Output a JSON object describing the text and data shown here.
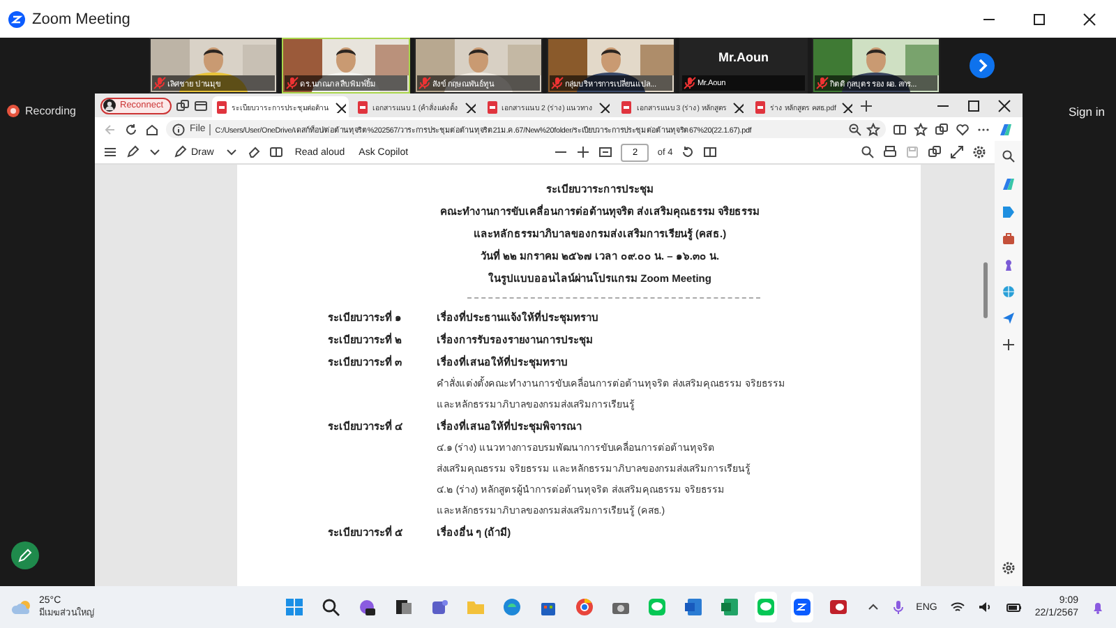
{
  "window": {
    "title": "Zoom Meeting"
  },
  "participants": [
    {
      "name": "เลิศชาย ปานมุข",
      "kind": "video",
      "muted": true,
      "speaking": false
    },
    {
      "name": "ดร.นภณภล สืบพิมพ์ยิ้ม",
      "kind": "video",
      "muted": true,
      "speaking": true
    },
    {
      "name": "สังข์ กฤษณพันธ์ทูน",
      "kind": "video",
      "muted": true,
      "speaking": false
    },
    {
      "name": "กลุ่มบริหารการเปลี่ยนแปล...",
      "kind": "video",
      "muted": true,
      "speaking": false
    },
    {
      "name": "Mr.Aoun",
      "kind": "name_only",
      "display": "Mr.Aoun",
      "muted": true,
      "speaking": false
    },
    {
      "name": "กิตติ กุลบุตร รอง ผอ. สกร...",
      "kind": "video",
      "muted": true,
      "speaking": false
    }
  ],
  "recording": {
    "label": "Recording"
  },
  "sign_in": "Sign in",
  "browser": {
    "profile_button": "Reconnect",
    "tabs": [
      {
        "label": "ระเบียบวาระการประชุมต่อต้าน",
        "selected": true
      },
      {
        "label": "เอกสารแนบ 1 (คำสั่งแต่งตั้ง",
        "selected": false
      },
      {
        "label": "เอกสารแนบ 2 (ร่าง) แนวทาง",
        "selected": false
      },
      {
        "label": "เอกสารแนบ 3 (ร่าง) หลักสูตร",
        "selected": false
      },
      {
        "label": "ร่าง หลักสูตร คสธ.pdf",
        "selected": false
      }
    ],
    "address": {
      "scheme": "File",
      "url": "C:/Users/User/OneDrive/เดสก์ท็อป/ต่อต้านทุจริต%202567/วาระการประชุมต่อต้านทุจริต21ม.ค.67/New%20folder/ระเบียบวาระการประชุมต่อต้านทุจริต67%20(22.1.67).pdf"
    },
    "pdf_toolbar": {
      "draw": "Draw",
      "read_aloud": "Read aloud",
      "ask_copilot": "Ask Copilot",
      "page": "2",
      "page_count": "of 4"
    },
    "document": {
      "heading": [
        "ระเบียบวาระการประชุม",
        "คณะทำงานการขับเคลื่อนการต่อต้านทุจริต ส่งเสริมคุณธรรม จริยธรรม",
        "และหลักธรรมาภิบาลของกรมส่งเสริมการเรียนรู้ (คสธ.)",
        "วันที่ ๒๒ มกราคม ๒๕๖๗ เวลา ๐๙.๐๐ น. – ๑๖.๓๐ น.",
        "ในรูปแบบออนไลน์ผ่านโปรแกรม Zoom Meeting"
      ],
      "agenda": [
        {
          "label": "ระเบียบวาระที่ ๑",
          "title": "เรื่องที่ประธานแจ้งให้ที่ประชุมทราบ"
        },
        {
          "label": "ระเบียบวาระที่ ๒",
          "title": "เรื่องการรับรองรายงานการประชุม"
        },
        {
          "label": "ระเบียบวาระที่ ๓",
          "title": "เรื่องที่เสนอให้ที่ประชุมทราบ",
          "details": [
            "คำสั่งแต่งตั้งคณะทำงานการขับเคลื่อนการต่อต้านทุจริต ส่งเสริมคุณธรรม จริยธรรม",
            "และหลักธรรมาภิบาลของกรมส่งเสริมการเรียนรู้"
          ]
        },
        {
          "label": "ระเบียบวาระที่ ๔",
          "title": "เรื่องที่เสนอให้ที่ประชุมพิจารณา",
          "details": [
            "๔.๑ (ร่าง) แนวทางการอบรมพัฒนาการขับเคลื่อนการต่อต้านทุจริต",
            "ส่งเสริมคุณธรรม จริยธรรม และหลักธรรมาภิบาลของกรมส่งเสริมการเรียนรู้",
            "๔.๒ (ร่าง) หลักสูตรผู้นำการต่อต้านทุจริต ส่งเสริมคุณธรรม จริยธรรม",
            "และหลักธรรมาภิบาลของกรมส่งเสริมการเรียนรู้ (คสธ.)"
          ]
        },
        {
          "label": "ระเบียบวาระที่ ๕",
          "title": "เรื่องอื่น ๆ (ถ้ามี)"
        }
      ]
    }
  },
  "taskbar": {
    "weather": {
      "temperature": "25°C",
      "condition": "มีเมฆส่วนใหญ่"
    },
    "language": "ENG",
    "time": "9:09",
    "date": "22/1/2567"
  }
}
